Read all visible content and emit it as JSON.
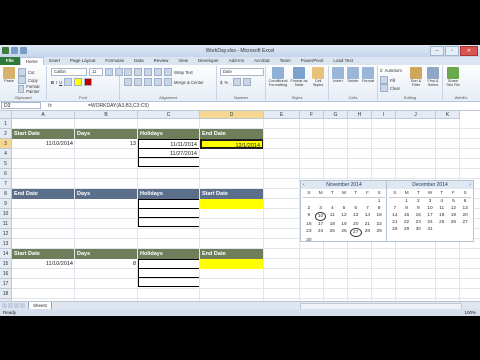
{
  "window": {
    "title": "WorkDay.xlsx - Microsoft Excel"
  },
  "tabs": [
    "File",
    "Home",
    "Insert",
    "Page Layout",
    "Formulas",
    "Data",
    "Review",
    "View",
    "Developer",
    "Add-Ins",
    "Acrobat",
    "Team",
    "PowerPivot",
    "Load Test"
  ],
  "ribbon": {
    "clipboard": {
      "paste": "Paste",
      "cut": "Cut",
      "copy": "Copy",
      "format_painter": "Format Painter",
      "label": "Clipboard"
    },
    "font": {
      "name": "Calibri",
      "size": "11",
      "label": "Font"
    },
    "alignment": {
      "wrap": "Wrap Text",
      "merge": "Merge & Center",
      "label": "Alignment"
    },
    "number": {
      "format": "Date",
      "label": "Number"
    },
    "styles": {
      "conditional": "Conditional Formatting",
      "format_table": "Format as Table",
      "cell_styles": "Cell Styles",
      "label": "Styles"
    },
    "cells": {
      "insert": "Insert",
      "delete": "Delete",
      "format": "Format",
      "label": "Cells"
    },
    "editing": {
      "autosum": "AutoSum",
      "fill": "Fill",
      "clear": "Clear",
      "sort": "Sort & Filter",
      "find": "Find & Select",
      "label": "Editing"
    },
    "extra": {
      "share": "Share This File",
      "webex": "WebEx"
    }
  },
  "formula_bar": {
    "name_box": "D3",
    "fx": "fx",
    "formula": "=WORKDAY(A3,B3,C3:C5)"
  },
  "columns": [
    "A",
    "B",
    "C",
    "D",
    "E",
    "F",
    "G",
    "H",
    "I",
    "J",
    "K"
  ],
  "rows": [
    "1",
    "2",
    "3",
    "4",
    "5",
    "6",
    "7",
    "8",
    "9",
    "10",
    "11",
    "12",
    "13",
    "14",
    "15",
    "16",
    "17",
    "18",
    "19"
  ],
  "table1": {
    "headers": [
      "Start Date",
      "Days",
      "Holidays",
      "End Date"
    ],
    "start": "11/10/2014",
    "days": "13",
    "holiday1": "11/11/2014",
    "holiday2": "11/27/2014",
    "end": "12/1/2014"
  },
  "table2": {
    "headers": [
      "End Date",
      "Days",
      "Holidays",
      "Start Date"
    ]
  },
  "table3": {
    "headers": [
      "Start Date",
      "Days",
      "Holidays",
      "End Date"
    ],
    "start": "11/10/2014",
    "days": "8"
  },
  "calendar_nov": {
    "title": "November 2014",
    "dow": [
      "S",
      "M",
      "T",
      "W",
      "T",
      "F",
      "S"
    ],
    "weeks": [
      [
        "",
        "",
        "",
        "",
        "",
        "",
        "1"
      ],
      [
        "2",
        "3",
        "4",
        "5",
        "6",
        "7",
        "8"
      ],
      [
        "9",
        "10",
        "11",
        "12",
        "13",
        "14",
        "15"
      ],
      [
        "16",
        "17",
        "18",
        "19",
        "20",
        "21",
        "22"
      ],
      [
        "23",
        "24",
        "25",
        "26",
        "27",
        "28",
        "29"
      ],
      [
        "30",
        "",
        "",
        "",
        "",
        "",
        ""
      ]
    ],
    "circled": [
      "10",
      "27"
    ]
  },
  "calendar_dec": {
    "title": "December 2014",
    "dow": [
      "S",
      "M",
      "T",
      "W",
      "T",
      "F",
      "S"
    ],
    "weeks": [
      [
        "",
        "1",
        "2",
        "3",
        "4",
        "5",
        "6"
      ],
      [
        "7",
        "8",
        "9",
        "10",
        "11",
        "12",
        "13"
      ],
      [
        "14",
        "15",
        "16",
        "17",
        "18",
        "19",
        "20"
      ],
      [
        "21",
        "22",
        "23",
        "24",
        "25",
        "26",
        "27"
      ],
      [
        "28",
        "29",
        "30",
        "31",
        "",
        "",
        ""
      ]
    ],
    "circled": []
  },
  "sheet_tab": "Sheet1",
  "status": {
    "ready": "Ready",
    "zoom": "100%"
  }
}
